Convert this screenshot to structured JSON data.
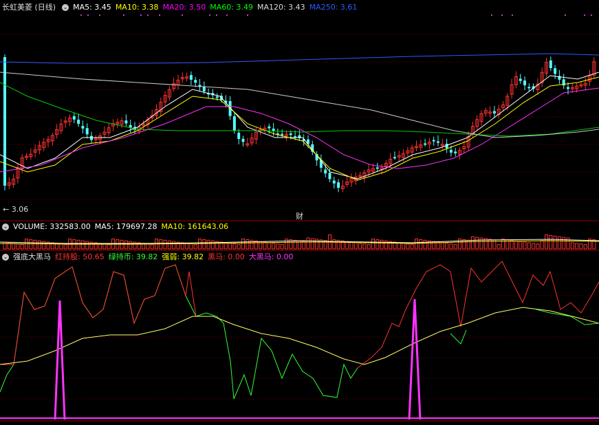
{
  "main_panel": {
    "title": "长虹美菱 (日线)",
    "indicators": [
      {
        "label": "MA5: 3.45",
        "color": "#ffffff"
      },
      {
        "label": "MA10: 3.38",
        "color": "#ffff00"
      },
      {
        "label": "MA20: 3.50",
        "color": "#ff00ff"
      },
      {
        "label": "MA60: 3.49",
        "color": "#00ff00"
      },
      {
        "label": "MA120: 3.43",
        "color": "#dddddd"
      },
      {
        "label": "MA250: 3.61",
        "color": "#2b5bff"
      }
    ],
    "low_marker": "3.06",
    "event_marker": "财"
  },
  "volume_panel": {
    "items": [
      {
        "label": "VOLUME: 332583.00",
        "color": "#ffffff"
      },
      {
        "label": "MA5: 179697.28",
        "color": "#ffffff"
      },
      {
        "label": "MA10: 161643.06",
        "color": "#ffff00"
      }
    ]
  },
  "indicator_panel": {
    "title": "强底大黑马",
    "items": [
      {
        "label": "红持股: 50.65",
        "color": "#ff3333"
      },
      {
        "label": "绿持币: 39.82",
        "color": "#33ff33"
      },
      {
        "label": "强弱: 39.82",
        "color": "#ffff00"
      },
      {
        "label": "黑马: 0.00",
        "color": "#ff3333"
      },
      {
        "label": "大黑马: 0.00",
        "color": "#ff33ff"
      }
    ]
  },
  "colors": {
    "up": "#ff3232",
    "down": "#54ffff",
    "grid": "#7a0000"
  }
}
